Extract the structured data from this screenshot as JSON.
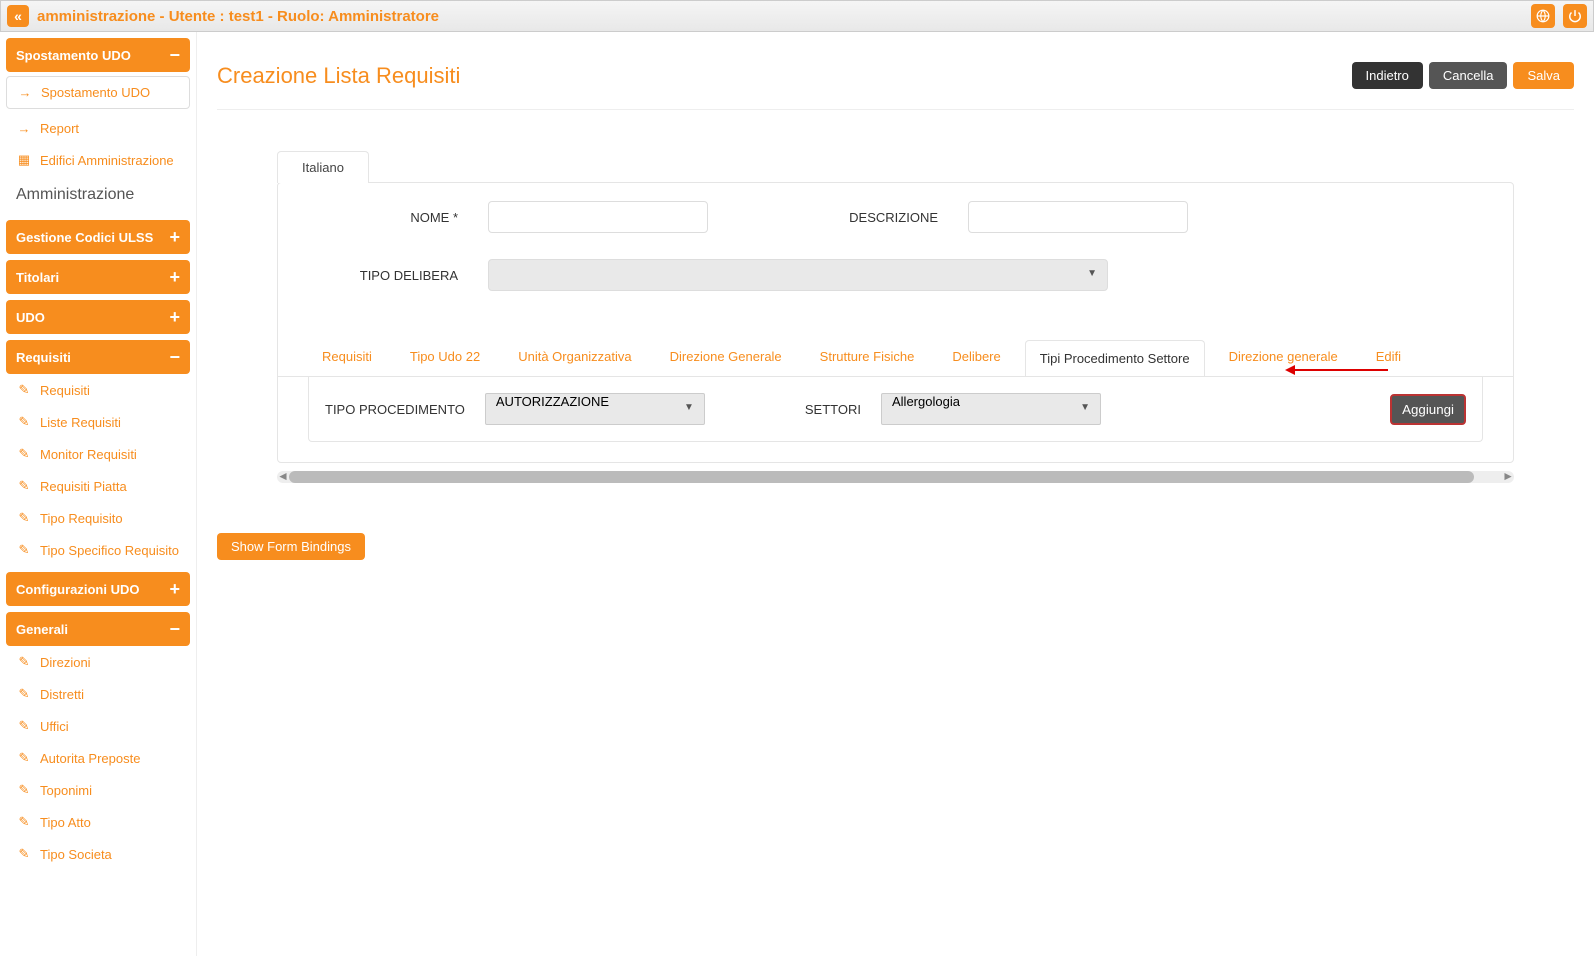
{
  "header": {
    "title": "amministrazione - Utente : test1 - Ruolo: Amministratore"
  },
  "sidebar": {
    "spostamento_header": "Spostamento UDO",
    "spostamento_item": "Spostamento UDO",
    "report_item": "Report",
    "edifici_item": "Edifici Amministrazione",
    "amministrazione_heading": "Amministrazione",
    "gestione_codici_header": "Gestione Codici ULSS",
    "titolari_header": "Titolari",
    "udo_header": "UDO",
    "requisiti_header": "Requisiti",
    "requisiti_items": {
      "0": "Requisiti",
      "1": "Liste Requisiti",
      "2": "Monitor Requisiti",
      "3": "Requisiti Piatta",
      "4": "Tipo Requisito",
      "5": "Tipo Specifico Requisito"
    },
    "configurazioni_header": "Configurazioni UDO",
    "generali_header": "Generali",
    "generali_items": {
      "0": "Direzioni",
      "1": "Distretti",
      "2": "Uffici",
      "3": "Autorita Preposte",
      "4": "Toponimi",
      "5": "Tipo Atto",
      "6": "Tipo Societa"
    }
  },
  "page": {
    "title": "Creazione Lista Requisiti",
    "btn_back": "Indietro",
    "btn_cancel": "Cancella",
    "btn_save": "Salva",
    "lang_tab": "Italiano",
    "form": {
      "nome_label": "NOME *",
      "descrizione_label": "DESCRIZIONE",
      "tipo_delibera_label": "TIPO DELIBERA"
    },
    "tabs": {
      "0": "Requisiti",
      "1": "Tipo Udo 22",
      "2": "Unità Organizzativa",
      "3": "Direzione Generale",
      "4": "Strutture Fisiche",
      "5": "Delibere",
      "6": "Tipi Procedimento Settore",
      "7": "Direzione generale",
      "8": "Edifi"
    },
    "tab_panel": {
      "tipo_procedimento_label": "TIPO PROCEDIMENTO",
      "tipo_procedimento_value": "AUTORIZZAZIONE",
      "settori_label": "SETTORI",
      "settori_value": "Allergologia",
      "add_btn": "Aggiungi"
    },
    "show_bindings": "Show Form Bindings"
  }
}
